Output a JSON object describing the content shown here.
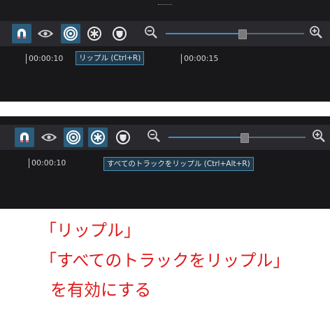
{
  "panel1": {
    "toolbar": {
      "buttons": [
        {
          "icon": "magnet-icon",
          "active": true
        },
        {
          "icon": "eye-icon",
          "active": false
        },
        {
          "icon": "ripple-target-icon",
          "active": true
        },
        {
          "icon": "ripple-all-icon",
          "active": false
        },
        {
          "icon": "shield-icon",
          "active": false
        }
      ],
      "zoom_out_icon": "zoom-out-icon",
      "zoom_in_icon": "zoom-in-icon",
      "zoom_level": 0.55
    },
    "ticks": [
      "00:00:10",
      "00:00:15"
    ],
    "tooltip": "リップル (Ctrl+R)"
  },
  "panel2": {
    "toolbar": {
      "buttons": [
        {
          "icon": "magnet-icon",
          "active": true
        },
        {
          "icon": "eye-icon",
          "active": false
        },
        {
          "icon": "ripple-target-icon",
          "active": true
        },
        {
          "icon": "ripple-all-icon",
          "active": true
        },
        {
          "icon": "shield-icon",
          "active": false
        }
      ],
      "zoom_out_icon": "zoom-out-icon",
      "zoom_in_icon": "zoom-in-icon",
      "zoom_level": 0.55
    },
    "ticks": [
      "00:00:10"
    ],
    "tooltip": "すべてのトラックをリップル (Ctrl+Alt+R)"
  },
  "caption": {
    "line1": "「リップル」",
    "line2": "「すべてのトラックをリップル」",
    "line3": "を有効にする",
    "color": "#e0191a"
  },
  "colors": {
    "active_button": "#2b5d7c",
    "panel_bg": "#18181b",
    "toolbar_bg": "#2a2a2e",
    "slider_fill": "#3a8fd0"
  }
}
